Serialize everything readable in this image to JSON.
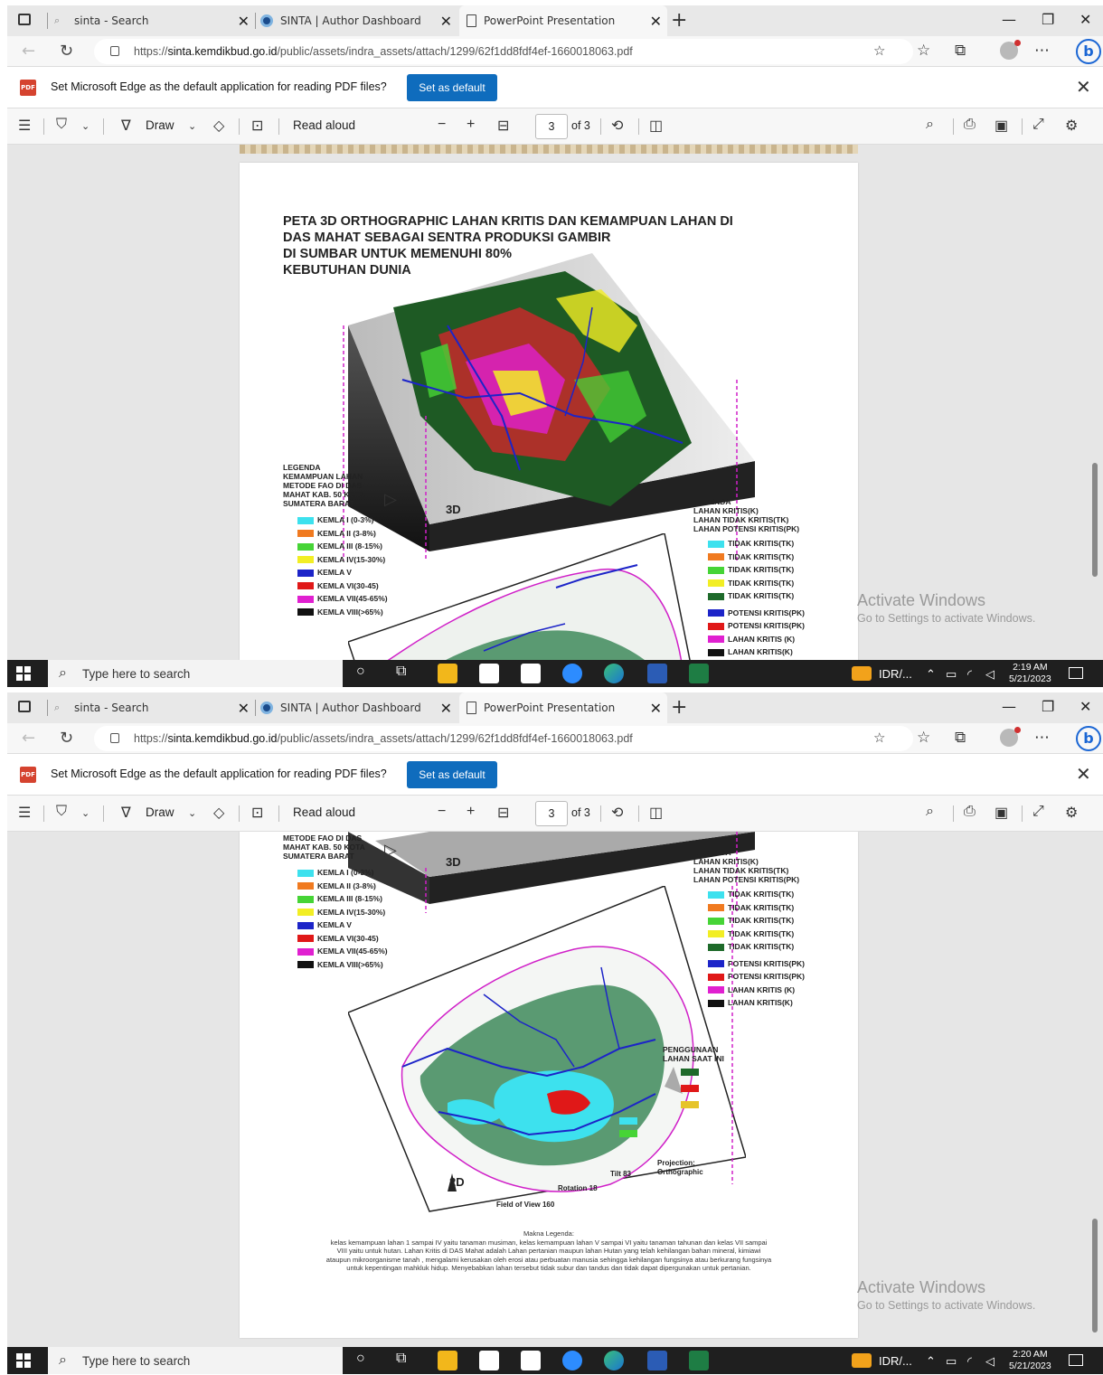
{
  "browser": {
    "tabs": [
      {
        "label": "sinta - Search"
      },
      {
        "label": "SINTA | Author Dashboard"
      },
      {
        "label": "PowerPoint Presentation"
      }
    ],
    "url_prefix": "https://",
    "url_host": "sinta.kemdikbud.go.id",
    "url_path": "/public/assets/indra_assets/attach/1299/62f1dd8fdf4ef-1660018063.pdf"
  },
  "infobar": {
    "message": "Set Microsoft Edge as the default application for reading PDF files?",
    "button": "Set as default"
  },
  "pdf_toolbar": {
    "draw_label": "Draw",
    "read_aloud_label": "Read aloud",
    "page_current": "3",
    "page_total": "of 3"
  },
  "map": {
    "title_lines": [
      "PETA 3D ORTHOGRAPHIC LAHAN KRITIS DAN KEMAMPUAN LAHAN DI",
      "DAS MAHAT SEBAGAI SENTRA PRODUKSI GAMBIR",
      "DI SUMBAR UNTUK MEMENUHI 80%",
      "KEBUTUHAN DUNIA"
    ],
    "legend_left_title": [
      "LEGENDA",
      "KEMAMPUAN LAHAN",
      "METODE FAO DI DAS",
      "MAHAT KAB. 50 KOTA",
      "SUMATERA BARAT"
    ],
    "legend_left": [
      {
        "label": "KEMLA I (0-3%)",
        "color": "#3de1ee"
      },
      {
        "label": "KEMLA II (3-8%)",
        "color": "#f07a20"
      },
      {
        "label": "KEMLA III (8-15%)",
        "color": "#46d436"
      },
      {
        "label": "KEMLA IV(15-30%)",
        "color": "#f2ee24"
      },
      {
        "label": "KEMLA V",
        "color": "#1c24c8"
      },
      {
        "label": "KEMLA VI(30-45)",
        "color": "#e01818"
      },
      {
        "label": "KEMLA VII(45-65%)",
        "color": "#e020d0"
      },
      {
        "label": "KEMLA VIII(>65%)",
        "color": "#111111"
      }
    ],
    "legend_right_title": [
      "LEGENDA",
      "LAHAN KRITIS(K)",
      "LAHAN TIDAK KRITIS(TK)",
      "LAHAN POTENSI KRITIS(PK)"
    ],
    "legend_right": [
      {
        "label": "TIDAK KRITIS(TK)",
        "color": "#3de1ee"
      },
      {
        "label": "TIDAK KRITIS(TK)",
        "color": "#f07a20"
      },
      {
        "label": "TIDAK KRITIS(TK)",
        "color": "#46d436"
      },
      {
        "label": "TIDAK KRITIS(TK)",
        "color": "#f2ee24"
      },
      {
        "label": "TIDAK KRITIS(TK)",
        "color": "#1e6a2a"
      },
      {
        "label": "POTENSI KRITIS(PK)",
        "color": "#1c24c8"
      },
      {
        "label": "POTENSI KRITIS(PK)",
        "color": "#e01818"
      },
      {
        "label": "LAHAN KRITIS (K)",
        "color": "#e020d0"
      },
      {
        "label": "LAHAN KRITIS(K)",
        "color": "#111111"
      }
    ],
    "label_3d": "3D",
    "label_2d": "2D",
    "penggunaan": [
      "PENGGUNAAN",
      "LAHAN SAAT INI"
    ],
    "tilt": "Tilt 83",
    "rotation": "Rotation 18",
    "fov": "Field of View 160",
    "projection": [
      "Projection:",
      "Orthographic"
    ],
    "makna_title": "Makna Legenda:",
    "makna_lines": [
      "kelas kemampuan lahan 1 sampai IV yaitu tanaman musiman, kelas kemampuan lahan V sampai  VI  yaitu tanaman tahunan dan kelas VII sampai",
      "VIII yaitu untuk hutan. Lahan Kritis di DAS Mahat adalah Lahan pertanian maupun lahan Hutan yang telah kehilangan  bahan mineral, kimiawi",
      "ataupun mikroorganisme  tanah , mengalami kerusakan oleh erosi atau perbuatan manusia sehingga kehilangan fungsinya atau berkurang fungsinya",
      "untuk kepentingan mahkluk hidup. Menyebabkan lahan tersebut tidak subur dan tandus dan tidak dapat dipergunakan untuk pertanian."
    ]
  },
  "watermark": {
    "line1": "Activate Windows",
    "line2": "Go to Settings to activate Windows."
  },
  "taskbar": {
    "search_placeholder": "Type here to search",
    "currency": "IDR/...",
    "shot1_time": "2:19 AM",
    "shot1_date": "5/21/2023",
    "shot2_time": "2:20 AM",
    "shot2_date": "5/21/2023"
  }
}
